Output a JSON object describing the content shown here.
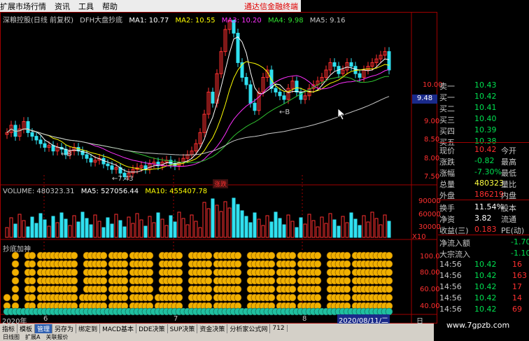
{
  "menu": {
    "items": [
      "扩展市场行情",
      "资讯",
      "工具",
      "帮助"
    ],
    "promo": "通达信金融终端"
  },
  "main_title": {
    "stock": "深粮控股(日线 前复权)",
    "indicator": "DFH大盘抄底",
    "ma1": "MA1: 10.77",
    "ma2": "MA2: 10.55",
    "ma3": "MA3: 10.20",
    "ma4": "MA4: 9.98",
    "ma5": "MA5: 9.16"
  },
  "colors": {
    "up": "#ff3030",
    "down": "#30e0f0",
    "ma1": "#ffffff",
    "ma2": "#ffff00",
    "ma3": "#ff30ff",
    "ma4": "#30c030",
    "ma5": "#c8c8c8",
    "coin": "#f0b000",
    "coin_green": "#20c0a0",
    "grid_red": "#a00000"
  },
  "price_axis": [
    "10.00",
    "9.48",
    "9.00",
    "8.50",
    "8.00",
    "7.50"
  ],
  "current_price_tag": "9.48",
  "annotations": {
    "low_price": "7.43",
    "b1": "B",
    "b2": "B",
    "cross_label": "涨跌"
  },
  "volume_title": {
    "volume": "VOLUME: 480323.31",
    "ma5": "MA5: 527056.44",
    "ma10": "MA10: 455407.78"
  },
  "volume_axis": [
    "90000",
    "60000",
    "30000",
    "X10"
  ],
  "sub_title": "抄底加神",
  "sub_axis": [
    "100.0",
    "80.00",
    "60.00",
    "40.00"
  ],
  "date_axis": [
    "2020年",
    "6",
    "7",
    "8",
    "2020/08/11/二",
    "日"
  ],
  "quote": {
    "rows": [
      {
        "l": "卖一",
        "p": "10.43",
        "v": ""
      },
      {
        "l": "买一",
        "p": "10.42",
        "v": ""
      },
      {
        "l": "买二",
        "p": "10.41",
        "v": ""
      },
      {
        "l": "买三",
        "p": "10.40",
        "v": ""
      },
      {
        "l": "买四",
        "p": "10.39",
        "v": ""
      },
      {
        "l": "买五",
        "p": "10.38",
        "v": ""
      },
      {
        "l": "现价",
        "p": "10.42",
        "v": "今开"
      },
      {
        "l": "涨跌",
        "p": "-0.82",
        "v": "最高"
      },
      {
        "l": "涨幅",
        "p": "-7.30%",
        "v": "最低"
      },
      {
        "l": "总量",
        "p": "480323",
        "v": "量比"
      },
      {
        "l": "外盘",
        "p": "186219",
        "v": "内盘"
      },
      {
        "l": "换手",
        "p": "11.54%",
        "v": "股本"
      },
      {
        "l": "净资",
        "p": "3.82",
        "v": "流通"
      },
      {
        "l": "收益(三)",
        "p": "0.183",
        "v": "PE(动)"
      },
      {
        "l": "净流入额",
        "p": "",
        "v": "-1.70"
      },
      {
        "l": "大宗流入",
        "p": "",
        "v": "-1.10"
      },
      {
        "l": "14:56",
        "p": "10.42",
        "v": "16"
      },
      {
        "l": "14:56",
        "p": "10.42",
        "v": "163"
      },
      {
        "l": "14:56",
        "p": "10.42",
        "v": "17"
      },
      {
        "l": "14:56",
        "p": "10.42",
        "v": "14"
      },
      {
        "l": "14:56",
        "p": "10.42",
        "v": "69"
      }
    ]
  },
  "tabs": [
    "指标",
    "模板",
    "管理",
    "另存为",
    "绑定到",
    "MACD基本",
    "DDE决策",
    "SUP决策",
    "资金决策",
    "分析家公式网",
    "712"
  ],
  "active_tab": "管理",
  "bottom_tabs": [
    "日线图",
    "扩展A",
    "关联报价"
  ],
  "watermark": "www.7gpzb.com"
}
